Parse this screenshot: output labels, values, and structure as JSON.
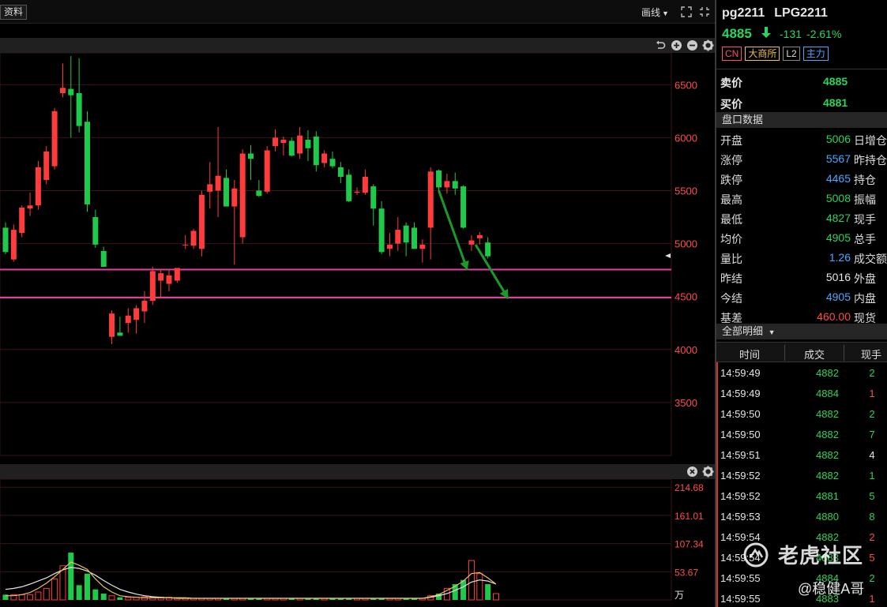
{
  "toolbar": {
    "data_button": "资料",
    "draw_label": "画线",
    "icons": [
      "fullscreen-icon",
      "restore-icon",
      "undo-icon",
      "zoom-in-icon",
      "zoom-out-icon",
      "gear-icon",
      "close-icon"
    ]
  },
  "colors": {
    "up": "#ff3b3b",
    "down": "#1fc94a",
    "support_line": "#e040a0",
    "arrow": "#1a9a2a",
    "grid": "#3a1515",
    "axis_text": "#ff4d4d",
    "ma_white": "#e6e6e6",
    "ma_yellow": "#e8c060"
  },
  "chart_data": [
    {
      "type": "candlestick",
      "ylim": [
        3000,
        6800
      ],
      "y_ticks": [
        "6500",
        "6000",
        "5500",
        "5000",
        "4500",
        "4000",
        "3500"
      ],
      "support_levels": [
        4755,
        4490
      ],
      "current_price_marker": 4885,
      "candles": [
        {
          "o": 5150,
          "h": 5200,
          "l": 4900,
          "c": 4920
        },
        {
          "o": 4850,
          "h": 5180,
          "l": 4830,
          "c": 5130
        },
        {
          "o": 5100,
          "h": 5360,
          "l": 5060,
          "c": 5340
        },
        {
          "o": 5330,
          "h": 5480,
          "l": 5260,
          "c": 5360
        },
        {
          "o": 5360,
          "h": 5780,
          "l": 5320,
          "c": 5720
        },
        {
          "o": 5600,
          "h": 5920,
          "l": 5560,
          "c": 5870
        },
        {
          "o": 5730,
          "h": 6280,
          "l": 5700,
          "c": 6250
        },
        {
          "o": 6420,
          "h": 6700,
          "l": 6380,
          "c": 6470
        },
        {
          "o": 6460,
          "h": 6770,
          "l": 6000,
          "c": 6400
        },
        {
          "o": 6420,
          "h": 6750,
          "l": 6050,
          "c": 6110
        },
        {
          "o": 6150,
          "h": 6250,
          "l": 5300,
          "c": 5370
        },
        {
          "o": 5250,
          "h": 5320,
          "l": 4960,
          "c": 4990
        },
        {
          "o": 4930,
          "h": 4970,
          "l": 4780,
          "c": 4780
        },
        {
          "o": 4120,
          "h": 4370,
          "l": 4050,
          "c": 4340
        },
        {
          "o": 4160,
          "h": 4310,
          "l": 4130,
          "c": 4130
        },
        {
          "o": 4250,
          "h": 4390,
          "l": 4160,
          "c": 4320
        },
        {
          "o": 4280,
          "h": 4420,
          "l": 4150,
          "c": 4390
        },
        {
          "o": 4360,
          "h": 4550,
          "l": 4250,
          "c": 4460
        },
        {
          "o": 4460,
          "h": 4780,
          "l": 4420,
          "c": 4740
        },
        {
          "o": 4650,
          "h": 4760,
          "l": 4480,
          "c": 4720
        },
        {
          "o": 4620,
          "h": 4760,
          "l": 4550,
          "c": 4700
        },
        {
          "o": 4650,
          "h": 4760,
          "l": 4630,
          "c": 4770
        },
        {
          "o": 4990,
          "h": 5080,
          "l": 4950,
          "c": 4990
        },
        {
          "o": 4980,
          "h": 5140,
          "l": 4950,
          "c": 5120
        },
        {
          "o": 4950,
          "h": 5500,
          "l": 4880,
          "c": 5460
        },
        {
          "o": 5490,
          "h": 5770,
          "l": 5330,
          "c": 5560
        },
        {
          "o": 5500,
          "h": 6100,
          "l": 5250,
          "c": 5640
        },
        {
          "o": 5620,
          "h": 5700,
          "l": 5400,
          "c": 5350
        },
        {
          "o": 5350,
          "h": 5600,
          "l": 4800,
          "c": 5520
        },
        {
          "o": 5060,
          "h": 5890,
          "l": 5000,
          "c": 5850
        },
        {
          "o": 5850,
          "h": 5930,
          "l": 5600,
          "c": 5800
        },
        {
          "o": 5500,
          "h": 5600,
          "l": 5440,
          "c": 5450
        },
        {
          "o": 5490,
          "h": 5920,
          "l": 5470,
          "c": 5880
        },
        {
          "o": 5920,
          "h": 6080,
          "l": 5870,
          "c": 6000
        },
        {
          "o": 5950,
          "h": 6010,
          "l": 5830,
          "c": 5980
        },
        {
          "o": 5970,
          "h": 6000,
          "l": 5820,
          "c": 5830
        },
        {
          "o": 5850,
          "h": 6100,
          "l": 5800,
          "c": 6020
        },
        {
          "o": 5980,
          "h": 6070,
          "l": 5780,
          "c": 5900
        },
        {
          "o": 6010,
          "h": 6060,
          "l": 5680,
          "c": 5740
        },
        {
          "o": 5760,
          "h": 5880,
          "l": 5720,
          "c": 5850
        },
        {
          "o": 5800,
          "h": 5870,
          "l": 5710,
          "c": 5730
        },
        {
          "o": 5720,
          "h": 5770,
          "l": 5570,
          "c": 5630
        },
        {
          "o": 5650,
          "h": 5700,
          "l": 5390,
          "c": 5400
        },
        {
          "o": 5480,
          "h": 5530,
          "l": 5460,
          "c": 5490
        },
        {
          "o": 5480,
          "h": 5700,
          "l": 5460,
          "c": 5630
        },
        {
          "o": 5540,
          "h": 5560,
          "l": 5170,
          "c": 5330
        },
        {
          "o": 5330,
          "h": 5400,
          "l": 4900,
          "c": 4920
        },
        {
          "o": 4950,
          "h": 5100,
          "l": 4880,
          "c": 4990
        },
        {
          "o": 5000,
          "h": 5250,
          "l": 4930,
          "c": 5130
        },
        {
          "o": 5170,
          "h": 5200,
          "l": 4880,
          "c": 5010
        },
        {
          "o": 5150,
          "h": 5200,
          "l": 4950,
          "c": 4950
        },
        {
          "o": 4950,
          "h": 5040,
          "l": 4820,
          "c": 4990
        },
        {
          "o": 5150,
          "h": 5720,
          "l": 4850,
          "c": 5680
        },
        {
          "o": 5690,
          "h": 5700,
          "l": 5480,
          "c": 5530
        },
        {
          "o": 5530,
          "h": 5660,
          "l": 5470,
          "c": 5590
        },
        {
          "o": 5590,
          "h": 5670,
          "l": 5460,
          "c": 5520
        },
        {
          "o": 5540,
          "h": 5550,
          "l": 5140,
          "c": 5150
        },
        {
          "o": 4990,
          "h": 5080,
          "l": 4930,
          "c": 5030
        },
        {
          "o": 5050,
          "h": 5110,
          "l": 4990,
          "c": 5080
        },
        {
          "o": 5010,
          "h": 5060,
          "l": 4860,
          "c": 4880
        }
      ],
      "arrows": [
        {
          "from": [
            53,
            5500
          ],
          "to": [
            56.5,
            4750
          ]
        },
        {
          "from": [
            57.5,
            4990
          ],
          "to": [
            61.5,
            4480
          ]
        }
      ]
    },
    {
      "type": "bar",
      "ylim": [
        0,
        230
      ],
      "y_ticks": [
        "214.68",
        "161.01",
        "107.34",
        "53.67"
      ],
      "unit": "万",
      "volumes": [
        10,
        10,
        10,
        10,
        15,
        22,
        40,
        65,
        90,
        28,
        50,
        20,
        12,
        8,
        5,
        5,
        5,
        6,
        5,
        5,
        5,
        4,
        3,
        3,
        3,
        3,
        3,
        3,
        3,
        3,
        3,
        3,
        3,
        3,
        3,
        3,
        3,
        3,
        3,
        3,
        3,
        3,
        3,
        3,
        3,
        3,
        3,
        3,
        3,
        3,
        3,
        3,
        8,
        12,
        22,
        30,
        38,
        75,
        50,
        30,
        12
      ],
      "ma_white": [
        20,
        22,
        25,
        30,
        36,
        42,
        50,
        57,
        62,
        60,
        55,
        47,
        37,
        28,
        20,
        15,
        11,
        8,
        6,
        5,
        4,
        4,
        4,
        3,
        3,
        3,
        3,
        3,
        3,
        3,
        3,
        3,
        3,
        3,
        3,
        3,
        3,
        3,
        3,
        3,
        3,
        3,
        3,
        3,
        3,
        3,
        3,
        3,
        3,
        3,
        3,
        3,
        5,
        8,
        12,
        18,
        25,
        34,
        38,
        36,
        30
      ],
      "ma_yellow": [
        8,
        8,
        10,
        14,
        22,
        32,
        44,
        58,
        72,
        66,
        58,
        40,
        25,
        15,
        8,
        6,
        5,
        4,
        4,
        4,
        4,
        3,
        3,
        3,
        3,
        3,
        3,
        3,
        3,
        3,
        3,
        3,
        3,
        3,
        3,
        3,
        3,
        3,
        3,
        3,
        3,
        3,
        3,
        3,
        3,
        3,
        3,
        3,
        3,
        3,
        3,
        3,
        6,
        10,
        18,
        26,
        36,
        50,
        52,
        42,
        30
      ]
    }
  ],
  "quote": {
    "code": "pg2211",
    "name": "LPG2211",
    "price": "4885",
    "change": "-131",
    "change_pct": "-2.61%",
    "tags": [
      "CN",
      "大商所",
      "L2",
      "主力"
    ],
    "ask_label": "卖价",
    "ask": "4885",
    "bid_label": "买价",
    "bid": "4881",
    "section_title": "盘口数据",
    "stats": [
      {
        "label": "开盘",
        "value": "5006",
        "color": "#2bd45c",
        "right_label": "日增仓"
      },
      {
        "label": "涨停",
        "value": "5567",
        "color": "#4aa8ff",
        "right_label": "昨持仓"
      },
      {
        "label": "跌停",
        "value": "4465",
        "color": "#4aa8ff",
        "right_label": "持仓"
      },
      {
        "label": "最高",
        "value": "5008",
        "color": "#2bd45c",
        "right_label": "振幅"
      },
      {
        "label": "最低",
        "value": "4827",
        "color": "#2bd45c",
        "right_label": "现手"
      },
      {
        "label": "均价",
        "value": "4905",
        "color": "#2bd45c",
        "right_label": "总手"
      },
      {
        "label": "量比",
        "value": "1.26",
        "color": "#4aa8ff",
        "right_label": "成交额"
      },
      {
        "label": "昨结",
        "value": "5016",
        "color": "#e6e6e6",
        "right_label": "外盘"
      },
      {
        "label": "今结",
        "value": "4905",
        "color": "#4aa8ff",
        "right_label": "内盘"
      },
      {
        "label": "基差",
        "value": "460.00",
        "color": "#ff4d4d",
        "right_label": "现货"
      }
    ],
    "detail_title": "全部明细",
    "tick_headers": [
      "时间",
      "成交",
      "现手"
    ],
    "ticks": [
      {
        "time": "14:59:49",
        "price": "4882",
        "vol": "2",
        "vol_color": "#2bd45c"
      },
      {
        "time": "14:59:49",
        "price": "4884",
        "vol": "1",
        "vol_color": "#ff4d4d"
      },
      {
        "time": "14:59:50",
        "price": "4882",
        "vol": "2",
        "vol_color": "#2bd45c"
      },
      {
        "time": "14:59:50",
        "price": "4882",
        "vol": "7",
        "vol_color": "#2bd45c"
      },
      {
        "time": "14:59:51",
        "price": "4882",
        "vol": "4",
        "vol_color": "#e6e6e6"
      },
      {
        "time": "14:59:52",
        "price": "4882",
        "vol": "1",
        "vol_color": "#2bd45c"
      },
      {
        "time": "14:59:52",
        "price": "4881",
        "vol": "5",
        "vol_color": "#2bd45c"
      },
      {
        "time": "14:59:53",
        "price": "4880",
        "vol": "8",
        "vol_color": "#2bd45c"
      },
      {
        "time": "14:59:54",
        "price": "4882",
        "vol": "2",
        "vol_color": "#ff4d4d"
      },
      {
        "time": "14:59:54",
        "price": "4883",
        "vol": "5",
        "vol_color": "#ff4d4d"
      },
      {
        "time": "14:59:55",
        "price": "4884",
        "vol": "2",
        "vol_color": "#2bd45c"
      },
      {
        "time": "14:59:55",
        "price": "4883",
        "vol": "1",
        "vol_color": "#ff4d4d"
      }
    ]
  },
  "watermark": {
    "brand": "老虎社区",
    "user": "@稳健A哥"
  }
}
